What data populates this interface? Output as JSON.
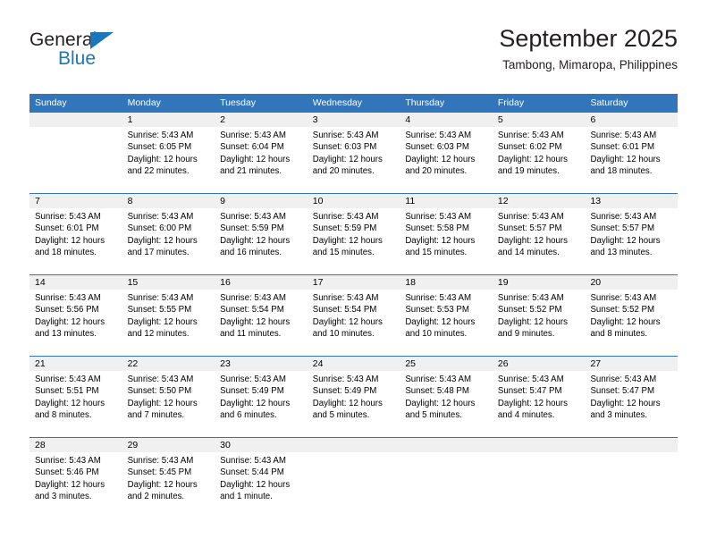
{
  "brand": {
    "name_part1": "General",
    "name_part2": "Blue",
    "triangle_color": "#1b76bc",
    "text_color": "#231f20"
  },
  "header": {
    "title": "September 2025",
    "subtitle": "Tambong, Mimaropa, Philippines"
  },
  "theme": {
    "header_band": "#3275ba",
    "daynum_band": "#f0f0f0",
    "week_separator": "#3275ba",
    "text": "#000000"
  },
  "weekdays": [
    "Sunday",
    "Monday",
    "Tuesday",
    "Wednesday",
    "Thursday",
    "Friday",
    "Saturday"
  ],
  "weeks": [
    {
      "days": [
        {
          "num": "",
          "sunrise": "",
          "sunset": "",
          "daylight_a": "",
          "daylight_b": "",
          "empty": true
        },
        {
          "num": "1",
          "sunrise": "Sunrise: 5:43 AM",
          "sunset": "Sunset: 6:05 PM",
          "daylight_a": "Daylight: 12 hours",
          "daylight_b": "and 22 minutes.",
          "empty": false
        },
        {
          "num": "2",
          "sunrise": "Sunrise: 5:43 AM",
          "sunset": "Sunset: 6:04 PM",
          "daylight_a": "Daylight: 12 hours",
          "daylight_b": "and 21 minutes.",
          "empty": false
        },
        {
          "num": "3",
          "sunrise": "Sunrise: 5:43 AM",
          "sunset": "Sunset: 6:03 PM",
          "daylight_a": "Daylight: 12 hours",
          "daylight_b": "and 20 minutes.",
          "empty": false
        },
        {
          "num": "4",
          "sunrise": "Sunrise: 5:43 AM",
          "sunset": "Sunset: 6:03 PM",
          "daylight_a": "Daylight: 12 hours",
          "daylight_b": "and 20 minutes.",
          "empty": false
        },
        {
          "num": "5",
          "sunrise": "Sunrise: 5:43 AM",
          "sunset": "Sunset: 6:02 PM",
          "daylight_a": "Daylight: 12 hours",
          "daylight_b": "and 19 minutes.",
          "empty": false
        },
        {
          "num": "6",
          "sunrise": "Sunrise: 5:43 AM",
          "sunset": "Sunset: 6:01 PM",
          "daylight_a": "Daylight: 12 hours",
          "daylight_b": "and 18 minutes.",
          "empty": false
        }
      ]
    },
    {
      "days": [
        {
          "num": "7",
          "sunrise": "Sunrise: 5:43 AM",
          "sunset": "Sunset: 6:01 PM",
          "daylight_a": "Daylight: 12 hours",
          "daylight_b": "and 18 minutes.",
          "empty": false
        },
        {
          "num": "8",
          "sunrise": "Sunrise: 5:43 AM",
          "sunset": "Sunset: 6:00 PM",
          "daylight_a": "Daylight: 12 hours",
          "daylight_b": "and 17 minutes.",
          "empty": false
        },
        {
          "num": "9",
          "sunrise": "Sunrise: 5:43 AM",
          "sunset": "Sunset: 5:59 PM",
          "daylight_a": "Daylight: 12 hours",
          "daylight_b": "and 16 minutes.",
          "empty": false
        },
        {
          "num": "10",
          "sunrise": "Sunrise: 5:43 AM",
          "sunset": "Sunset: 5:59 PM",
          "daylight_a": "Daylight: 12 hours",
          "daylight_b": "and 15 minutes.",
          "empty": false
        },
        {
          "num": "11",
          "sunrise": "Sunrise: 5:43 AM",
          "sunset": "Sunset: 5:58 PM",
          "daylight_a": "Daylight: 12 hours",
          "daylight_b": "and 15 minutes.",
          "empty": false
        },
        {
          "num": "12",
          "sunrise": "Sunrise: 5:43 AM",
          "sunset": "Sunset: 5:57 PM",
          "daylight_a": "Daylight: 12 hours",
          "daylight_b": "and 14 minutes.",
          "empty": false
        },
        {
          "num": "13",
          "sunrise": "Sunrise: 5:43 AM",
          "sunset": "Sunset: 5:57 PM",
          "daylight_a": "Daylight: 12 hours",
          "daylight_b": "and 13 minutes.",
          "empty": false
        }
      ]
    },
    {
      "days": [
        {
          "num": "14",
          "sunrise": "Sunrise: 5:43 AM",
          "sunset": "Sunset: 5:56 PM",
          "daylight_a": "Daylight: 12 hours",
          "daylight_b": "and 13 minutes.",
          "empty": false
        },
        {
          "num": "15",
          "sunrise": "Sunrise: 5:43 AM",
          "sunset": "Sunset: 5:55 PM",
          "daylight_a": "Daylight: 12 hours",
          "daylight_b": "and 12 minutes.",
          "empty": false
        },
        {
          "num": "16",
          "sunrise": "Sunrise: 5:43 AM",
          "sunset": "Sunset: 5:54 PM",
          "daylight_a": "Daylight: 12 hours",
          "daylight_b": "and 11 minutes.",
          "empty": false
        },
        {
          "num": "17",
          "sunrise": "Sunrise: 5:43 AM",
          "sunset": "Sunset: 5:54 PM",
          "daylight_a": "Daylight: 12 hours",
          "daylight_b": "and 10 minutes.",
          "empty": false
        },
        {
          "num": "18",
          "sunrise": "Sunrise: 5:43 AM",
          "sunset": "Sunset: 5:53 PM",
          "daylight_a": "Daylight: 12 hours",
          "daylight_b": "and 10 minutes.",
          "empty": false
        },
        {
          "num": "19",
          "sunrise": "Sunrise: 5:43 AM",
          "sunset": "Sunset: 5:52 PM",
          "daylight_a": "Daylight: 12 hours",
          "daylight_b": "and 9 minutes.",
          "empty": false
        },
        {
          "num": "20",
          "sunrise": "Sunrise: 5:43 AM",
          "sunset": "Sunset: 5:52 PM",
          "daylight_a": "Daylight: 12 hours",
          "daylight_b": "and 8 minutes.",
          "empty": false
        }
      ]
    },
    {
      "days": [
        {
          "num": "21",
          "sunrise": "Sunrise: 5:43 AM",
          "sunset": "Sunset: 5:51 PM",
          "daylight_a": "Daylight: 12 hours",
          "daylight_b": "and 8 minutes.",
          "empty": false
        },
        {
          "num": "22",
          "sunrise": "Sunrise: 5:43 AM",
          "sunset": "Sunset: 5:50 PM",
          "daylight_a": "Daylight: 12 hours",
          "daylight_b": "and 7 minutes.",
          "empty": false
        },
        {
          "num": "23",
          "sunrise": "Sunrise: 5:43 AM",
          "sunset": "Sunset: 5:49 PM",
          "daylight_a": "Daylight: 12 hours",
          "daylight_b": "and 6 minutes.",
          "empty": false
        },
        {
          "num": "24",
          "sunrise": "Sunrise: 5:43 AM",
          "sunset": "Sunset: 5:49 PM",
          "daylight_a": "Daylight: 12 hours",
          "daylight_b": "and 5 minutes.",
          "empty": false
        },
        {
          "num": "25",
          "sunrise": "Sunrise: 5:43 AM",
          "sunset": "Sunset: 5:48 PM",
          "daylight_a": "Daylight: 12 hours",
          "daylight_b": "and 5 minutes.",
          "empty": false
        },
        {
          "num": "26",
          "sunrise": "Sunrise: 5:43 AM",
          "sunset": "Sunset: 5:47 PM",
          "daylight_a": "Daylight: 12 hours",
          "daylight_b": "and 4 minutes.",
          "empty": false
        },
        {
          "num": "27",
          "sunrise": "Sunrise: 5:43 AM",
          "sunset": "Sunset: 5:47 PM",
          "daylight_a": "Daylight: 12 hours",
          "daylight_b": "and 3 minutes.",
          "empty": false
        }
      ]
    },
    {
      "days": [
        {
          "num": "28",
          "sunrise": "Sunrise: 5:43 AM",
          "sunset": "Sunset: 5:46 PM",
          "daylight_a": "Daylight: 12 hours",
          "daylight_b": "and 3 minutes.",
          "empty": false
        },
        {
          "num": "29",
          "sunrise": "Sunrise: 5:43 AM",
          "sunset": "Sunset: 5:45 PM",
          "daylight_a": "Daylight: 12 hours",
          "daylight_b": "and 2 minutes.",
          "empty": false
        },
        {
          "num": "30",
          "sunrise": "Sunrise: 5:43 AM",
          "sunset": "Sunset: 5:44 PM",
          "daylight_a": "Daylight: 12 hours",
          "daylight_b": "and 1 minute.",
          "empty": false
        },
        {
          "num": "",
          "sunrise": "",
          "sunset": "",
          "daylight_a": "",
          "daylight_b": "",
          "empty": true
        },
        {
          "num": "",
          "sunrise": "",
          "sunset": "",
          "daylight_a": "",
          "daylight_b": "",
          "empty": true
        },
        {
          "num": "",
          "sunrise": "",
          "sunset": "",
          "daylight_a": "",
          "daylight_b": "",
          "empty": true
        },
        {
          "num": "",
          "sunrise": "",
          "sunset": "",
          "daylight_a": "",
          "daylight_b": "",
          "empty": true
        }
      ]
    }
  ]
}
